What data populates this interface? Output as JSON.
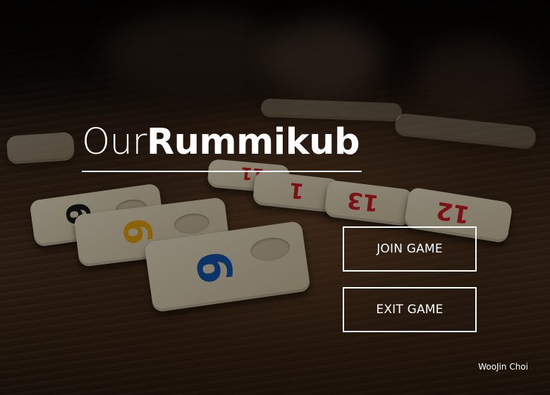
{
  "app": {
    "title_light": "Our",
    "title_bold": "Rummikub"
  },
  "menu": {
    "join_label": "JOIN GAME",
    "exit_label": "EXIT GAME"
  },
  "footer": {
    "author": "WooJin Choi"
  },
  "background": {
    "tiles": [
      {
        "num": "6",
        "color": "#151515"
      },
      {
        "num": "6",
        "color": "#e0a010"
      },
      {
        "num": "6",
        "color": "#1453a8"
      },
      {
        "num": "1",
        "color": "#c81b22"
      },
      {
        "num": "13",
        "color": "#c81b22"
      },
      {
        "num": "12",
        "color": "#c81b22"
      },
      {
        "num": "11",
        "color": "#c81b22"
      }
    ]
  }
}
